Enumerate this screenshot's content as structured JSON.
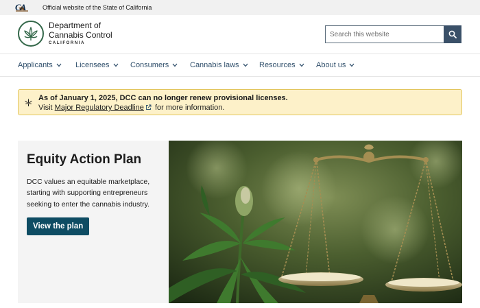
{
  "utility": {
    "logo_text": "CA",
    "official_text": "Official website of the State of California"
  },
  "header": {
    "dept_line1": "Department of",
    "dept_line2": "Cannabis Control",
    "state": "CALIFORNIA"
  },
  "search": {
    "placeholder": "Search this website"
  },
  "nav": {
    "items": [
      {
        "label": "Applicants"
      },
      {
        "label": "Licensees"
      },
      {
        "label": "Consumers"
      },
      {
        "label": "Cannabis laws"
      },
      {
        "label": "Resources"
      },
      {
        "label": "About us"
      }
    ]
  },
  "alert": {
    "title": "As of January 1, 2025, DCC can no longer renew provisional licenses.",
    "body_prefix": "Visit",
    "link_text": "Major Regulatory Deadline",
    "body_suffix": "for more information."
  },
  "hero": {
    "title": "Equity Action Plan",
    "text": "DCC values an equitable marketplace, starting with supporting entrepreneurs seeking to enter the cannabis industry.",
    "button_label": "View the plan"
  },
  "colors": {
    "brand_green": "#34684a",
    "nav_text": "#31506c",
    "button": "#0e4c63",
    "alert_bg": "#fdf1c9",
    "alert_border": "#e2c55b"
  },
  "icons": [
    "ca-logo",
    "cannabis-leaf-icon",
    "search-icon",
    "chevron-down-icon",
    "cannabis-leaf-icon",
    "external-link-icon"
  ]
}
